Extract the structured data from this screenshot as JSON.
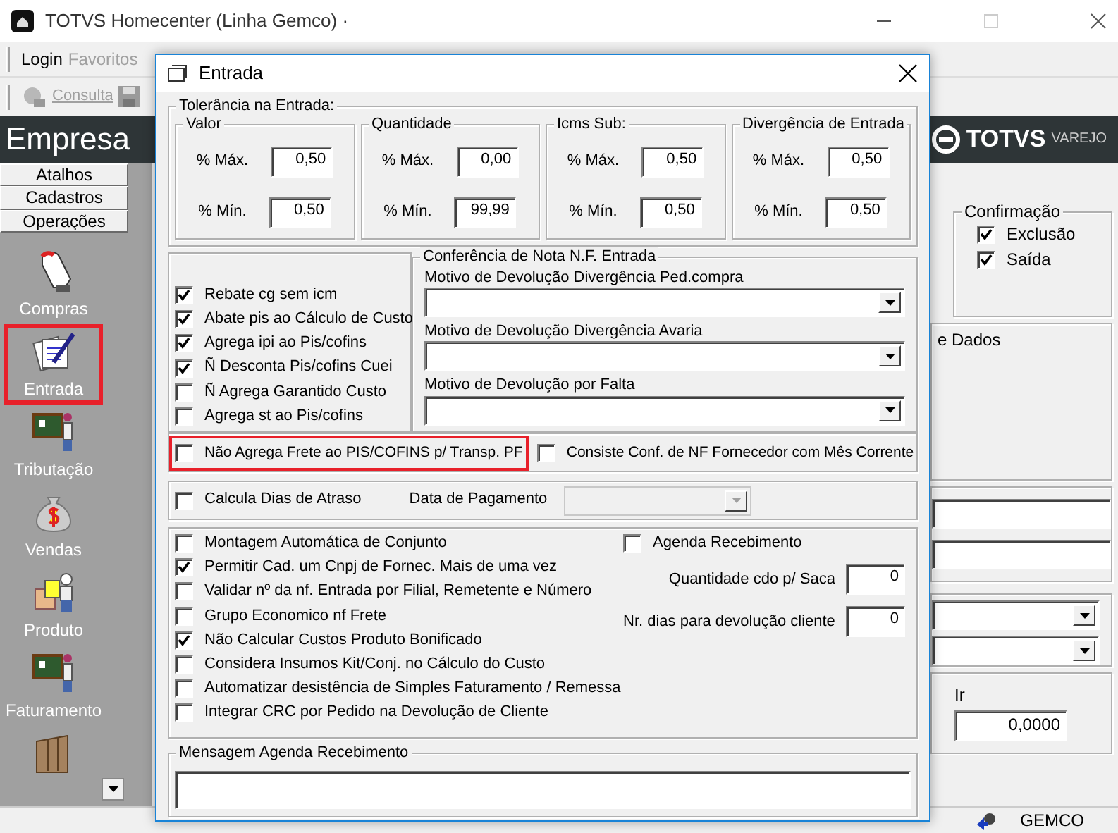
{
  "window": {
    "title": "TOTVS Homecenter (Linha Gemco) ·"
  },
  "menu": [
    {
      "label": "Login",
      "disabled": false
    },
    {
      "label": "Favoritos",
      "disabled": true
    }
  ],
  "toolbar": {
    "label": "Consulta",
    "disabled": true
  },
  "header": {
    "title": "Empresa",
    "logo": {
      "brand": "TOTVS",
      "sub": "VAREJO"
    }
  },
  "sidebar": {
    "tabs": [
      {
        "label": "Atalhos"
      },
      {
        "label": "Cadastros"
      },
      {
        "label": "Operações"
      }
    ],
    "items": [
      {
        "label": "Compras",
        "kind": "hand",
        "highlighted": false
      },
      {
        "label": "Entrada",
        "kind": "documents",
        "highlighted": true
      },
      {
        "label": "Tributação",
        "kind": "teacher",
        "highlighted": false
      },
      {
        "label": "Vendas",
        "kind": "moneybag",
        "highlighted": false
      },
      {
        "label": "Produto",
        "kind": "worker",
        "highlighted": false
      },
      {
        "label": "Faturamento",
        "kind": "teacher",
        "highlighted": false
      },
      {
        "kind": "cabinet",
        "highlighted": false
      }
    ]
  },
  "background": {
    "confirmation": {
      "title": "Confirmação",
      "options": [
        {
          "label": "Exclusão",
          "checked": true
        },
        {
          "label": "Saída",
          "checked": true
        }
      ]
    },
    "partial_label": "e Dados",
    "ir": {
      "label": "Ir",
      "value": "0,0000"
    }
  },
  "status_bar": {
    "user": "GEMCO"
  },
  "dialog": {
    "title": "Entrada",
    "tolerance": {
      "title": "Tolerância na Entrada:",
      "groups": [
        {
          "title": "Valor",
          "max_label": "% Máx.",
          "max": "0,50",
          "min_label": "% Mín.",
          "min": "0,50"
        },
        {
          "title": "Quantidade",
          "max_label": "% Máx.",
          "max": "0,00",
          "min_label": "% Mín.",
          "min": "99,99"
        },
        {
          "title": "Icms Sub:",
          "max_label": "% Máx.",
          "max": "0,50",
          "min_label": "% Mín.",
          "min": "0,50"
        },
        {
          "title": "Divergência de Entrada",
          "max_label": "% Máx.",
          "max": "0,50",
          "min_label": "% Mín.",
          "min": "0,50"
        }
      ]
    },
    "options": [
      {
        "label": "Rebate cg sem icm",
        "checked": true,
        "highlighted": false
      },
      {
        "label": "Abate pis ao Cálculo de Custo",
        "checked": true,
        "highlighted": false
      },
      {
        "label": "Agrega ipi ao Pis/cofins",
        "checked": true,
        "highlighted": false
      },
      {
        "label": "Ñ Desconta Pis/cofins Cuei",
        "checked": true,
        "highlighted": false
      },
      {
        "label": "Ñ Agrega Garantido Custo",
        "checked": false,
        "highlighted": false
      },
      {
        "label": "Agrega st ao Pis/cofins",
        "checked": false,
        "highlighted": false
      }
    ],
    "conference": {
      "title": "Conferência de Nota N.F. Entrada",
      "fields": [
        {
          "label": "Motivo de Devolução Divergência Ped.compra"
        },
        {
          "label": "Motivo de Devolução Divergência Avaria"
        },
        {
          "label": "Motivo de Devolução por Falta"
        }
      ]
    },
    "freight_row": [
      {
        "label": "Não Agrega Frete ao PIS/COFINS p/ Transp. PF",
        "checked": false,
        "highlighted": true
      },
      {
        "label": "Consiste Conf. de NF Fornecedor com Mês Corrente",
        "checked": false,
        "highlighted": false
      }
    ],
    "delay": {
      "checkbox": {
        "label": "Calcula Dias de Atraso",
        "checked": false,
        "highlighted": false
      },
      "date_label": "Data de Pagamento",
      "date_disabled": true
    },
    "more_options": [
      {
        "label": "Montagem Automática de Conjunto",
        "checked": false,
        "highlighted": false
      },
      {
        "label": "Permitir Cad. um Cnpj de Fornec. Mais de uma vez",
        "checked": true,
        "highlighted": false
      },
      {
        "label": "Validar nº da nf. Entrada por Filial, Remetente e Número",
        "checked": false,
        "highlighted": false
      },
      {
        "label": "Grupo Economico nf Frete",
        "checked": false,
        "highlighted": false
      },
      {
        "label": "Não Calcular Custos Produto Bonificado",
        "checked": true,
        "highlighted": false
      },
      {
        "label": "Considera Insumos Kit/Conj. no Cálculo do Custo",
        "checked": false,
        "highlighted": false
      },
      {
        "label": "Automatizar desistência de Simples Faturamento / Remessa",
        "checked": false,
        "highlighted": false
      },
      {
        "label": "Integrar CRC por Pedido na Devolução de Cliente",
        "checked": false,
        "highlighted": false
      }
    ],
    "agenda": {
      "label": "Agenda Recebimento",
      "checked": false,
      "highlighted": false
    },
    "numeric_fields": [
      {
        "label": "Quantidade cdo p/ Saca",
        "value": "0"
      },
      {
        "label": "Nr. dias para devolução cliente",
        "value": "0"
      }
    ],
    "message": {
      "title": "Mensagem Agenda Recebimento"
    }
  }
}
